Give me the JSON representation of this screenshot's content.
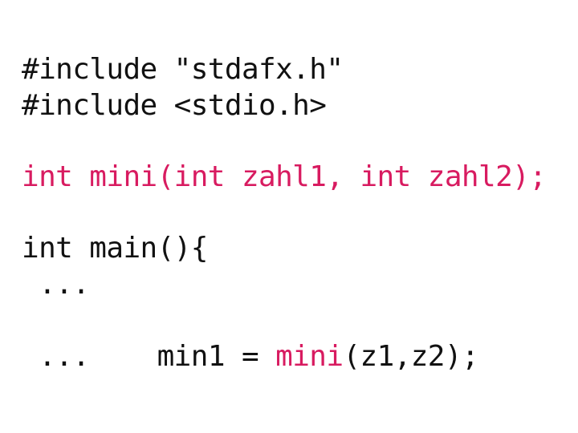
{
  "slide": {
    "background_color": "#ffffff",
    "code_color": "#111111",
    "highlight_color": "#d81b60",
    "language": "c"
  },
  "code": {
    "lines": [
      {
        "id": "include-stdafx",
        "text": "#include \"stdafx.h\"",
        "color": "#111111"
      },
      {
        "id": "include-stdio",
        "text": "#include <stdio.h>",
        "color": "#111111"
      },
      {
        "id": "blank-1",
        "text": "",
        "color": "#111111"
      },
      {
        "id": "prototype-mini",
        "text": "int mini(int zahl1, int zahl2);",
        "color": "#d81b60"
      },
      {
        "id": "blank-2",
        "text": "",
        "color": "#111111"
      },
      {
        "id": "main-open",
        "text": "int main(){",
        "color": "#111111"
      },
      {
        "id": "ellipsis-1",
        "text": " ...",
        "color": "#111111"
      },
      {
        "id": "call-mini",
        "segments": [
          {
            "text": "  min1 = ",
            "color": "#111111"
          },
          {
            "text": "mini",
            "color": "#d81b60"
          },
          {
            "text": "(z1,z2);",
            "color": "#111111"
          }
        ]
      },
      {
        "id": "ellipsis-2",
        "text": " ...",
        "color": "#111111"
      }
    ]
  }
}
